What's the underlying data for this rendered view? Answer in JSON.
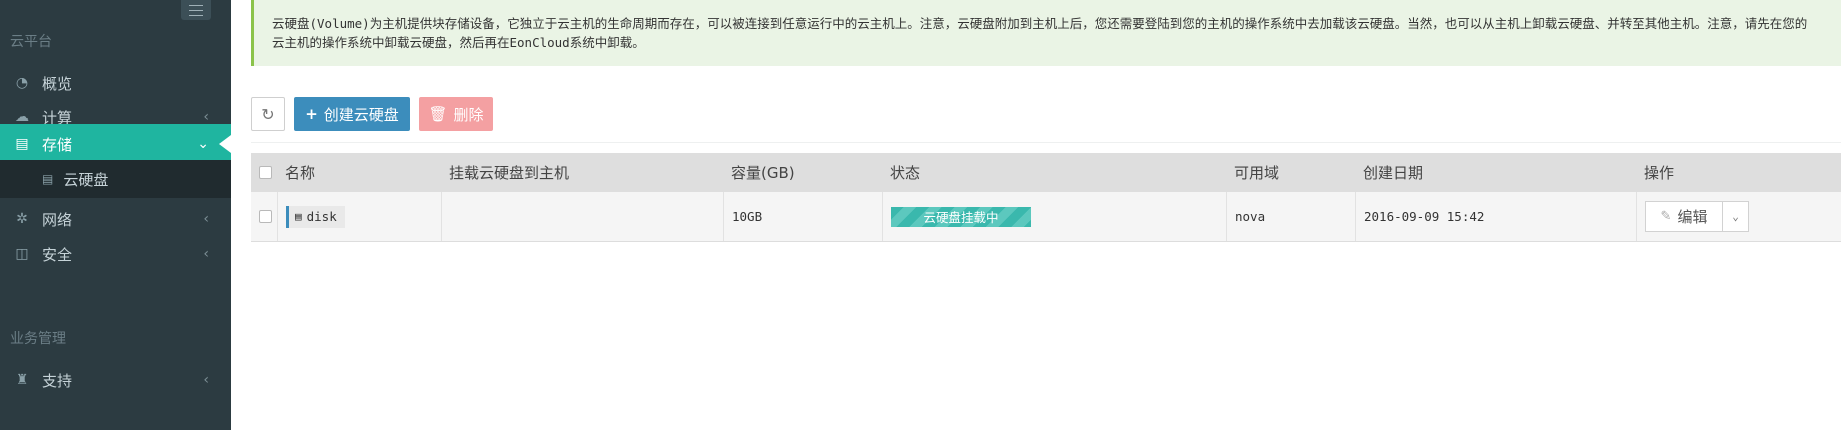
{
  "sidebar": {
    "platform_header": "云平台",
    "business_header": "业务管理",
    "items": [
      {
        "label": "概览",
        "icon": "dashboard-icon"
      },
      {
        "label": "计算",
        "icon": "cloud-icon",
        "chevron": "‹"
      },
      {
        "label": "存储",
        "icon": "database-icon",
        "chevron": "⌄",
        "active": true
      },
      {
        "label": "云硬盘",
        "icon": "disk-icon"
      },
      {
        "label": "网络",
        "icon": "network-icon",
        "chevron": "‹"
      },
      {
        "label": "安全",
        "icon": "shield-icon",
        "chevron": "‹"
      },
      {
        "label": "支持",
        "icon": "support-icon",
        "chevron": "‹"
      }
    ]
  },
  "notice": {
    "text": "云硬盘(Volume)为主机提供块存储设备，它独立于云主机的生命周期而存在，可以被连接到任意运行中的云主机上。注意，云硬盘附加到主机上后，您还需要登陆到您的主机的操作系统中去加载该云硬盘。当然，也可以从主机上卸载云硬盘、并转至其他主机。注意，请先在您的\n云主机的操作系统中卸载云硬盘，然后再在EonCloud系统中卸载。"
  },
  "toolbar": {
    "refresh_icon": "↻",
    "create_label": "创建云硬盘",
    "delete_label": "删除"
  },
  "table": {
    "headers": [
      "名称",
      "挂载云硬盘到主机",
      "容量(GB)",
      "状态",
      "可用域",
      "创建日期",
      "操作"
    ],
    "rows": [
      {
        "name": "disk",
        "attached_host": "",
        "capacity": "10GB",
        "status": "云硬盘挂载中",
        "zone": "nova",
        "created": "2016-09-09 15:42",
        "action": "编辑"
      }
    ]
  },
  "colors": {
    "sidebar_bg": "#2c3b41",
    "active_item": "#1fb5a0",
    "primary": "#3c8dbc",
    "danger_light": "#f4a0a2",
    "status_teal": "#3ab8ad",
    "notice_bg": "#eaf4e5"
  }
}
